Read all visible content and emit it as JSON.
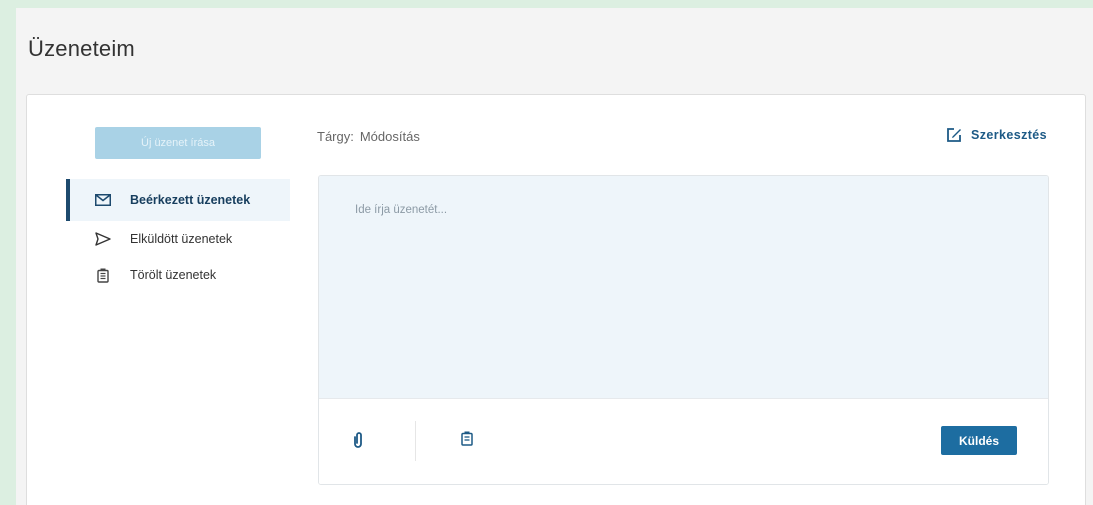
{
  "page": {
    "title": "Üzeneteim"
  },
  "sidebar": {
    "new_message_label": "Új üzenet írása",
    "folders": [
      {
        "label": "Beérkezett üzenetek",
        "icon": "mail-icon",
        "active": true
      },
      {
        "label": "Elküldött üzenetek",
        "icon": "send-icon",
        "active": false
      },
      {
        "label": "Törölt üzenetek",
        "icon": "trash-icon",
        "active": false
      }
    ]
  },
  "compose": {
    "subject_label": "Tárgy:",
    "subject_value": "Módosítás",
    "edit_label": "Szerkesztés",
    "placeholder": "Ide írja üzenetét...",
    "send_label": "Küldés"
  },
  "colors": {
    "accent": "#1d6da1",
    "active_bar": "#1d4a6e",
    "disabled_button": "#a9d2e6",
    "textarea_bg": "#eef5fa"
  }
}
